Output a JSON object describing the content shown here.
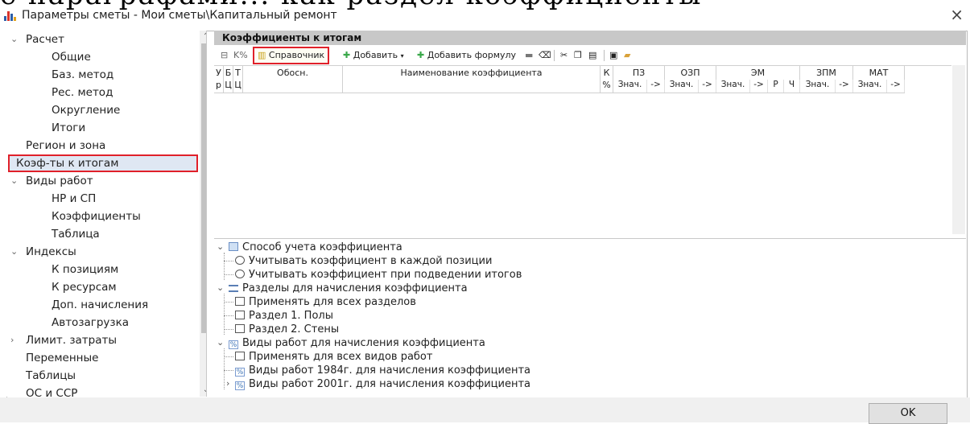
{
  "cut_text": "е параграфами... как раздел коэффициенты",
  "window": {
    "title": "Параметры сметы - Мои сметы\\Капитальный ремонт",
    "close_glyph": "×"
  },
  "nav": {
    "items": [
      {
        "label": "Расчет",
        "level": 0,
        "chev": "⌄"
      },
      {
        "label": "Общие",
        "level": 1
      },
      {
        "label": "Баз. метод",
        "level": 1
      },
      {
        "label": "Рес. метод",
        "level": 1
      },
      {
        "label": "Округление",
        "level": 1
      },
      {
        "label": "Итоги",
        "level": 1
      },
      {
        "label": "Регион и зона",
        "level": 0
      },
      {
        "label": "Коэф-ты к итогам",
        "level": 0,
        "selected": true
      },
      {
        "label": "Виды работ",
        "level": 0,
        "chev": "⌄"
      },
      {
        "label": "НР и СП",
        "level": 1
      },
      {
        "label": "Коэффициенты",
        "level": 1
      },
      {
        "label": "Таблица",
        "level": 1
      },
      {
        "label": "Индексы",
        "level": 0,
        "chev": "⌄"
      },
      {
        "label": "К позициям",
        "level": 1
      },
      {
        "label": "К ресурсам",
        "level": 1
      },
      {
        "label": "Доп. начисления",
        "level": 1
      },
      {
        "label": "Автозагрузка",
        "level": 1
      },
      {
        "label": "Лимит. затраты",
        "level": 0,
        "chev": "›"
      },
      {
        "label": "Переменные",
        "level": 0
      },
      {
        "label": "Таблицы",
        "level": 0
      },
      {
        "label": "ОС и ССР",
        "level": 0
      }
    ]
  },
  "panel": {
    "title": "Коэффициенты к итогам",
    "toolbar": {
      "ref_label": "Справочник",
      "add_label": "Добавить",
      "add_formula_label": "Добавить формулу"
    },
    "grid": {
      "headers": {
        "ur": [
          "У",
          "р"
        ],
        "bc": [
          "Б",
          "Ц"
        ],
        "tc": [
          "Т",
          "Ц"
        ],
        "obosn": "Обосн.",
        "name": "Наименование коэффициента",
        "k": [
          "К",
          "%"
        ],
        "pz": "ПЗ",
        "ozp": "ОЗП",
        "em": "ЭМ",
        "zpm": "ЗПМ",
        "mat": "МАТ"
      },
      "sub_val": "Знач.",
      "sub_arrow": "->",
      "sub_r": "Р",
      "sub_ch": "Ч"
    },
    "options": {
      "group1": "Способ учета коэффициента",
      "g1_opt1": "Учитывать коэффициент в каждой позиции",
      "g1_opt2": "Учитывать коэффициент при подведении итогов",
      "group2": "Разделы для начисления коэффициента",
      "g2_opt1": "Применять для всех разделов",
      "g2_opt2": "Раздел 1. Полы",
      "g2_opt3": "Раздел 2. Стены",
      "group3": "Виды работ для начисления коэффициента",
      "g3_opt1": "Применять для всех видов работ",
      "g3_opt2": "Виды работ 1984г. для начисления коэффициента",
      "g3_opt3": "Виды работ 2001г. для начисления коэффициента"
    }
  },
  "footer": {
    "ok_label": "OK"
  },
  "colors": {
    "highlight": "#e0202a",
    "header_bg": "#c8c8c8",
    "add_green": "#3aa84a"
  }
}
